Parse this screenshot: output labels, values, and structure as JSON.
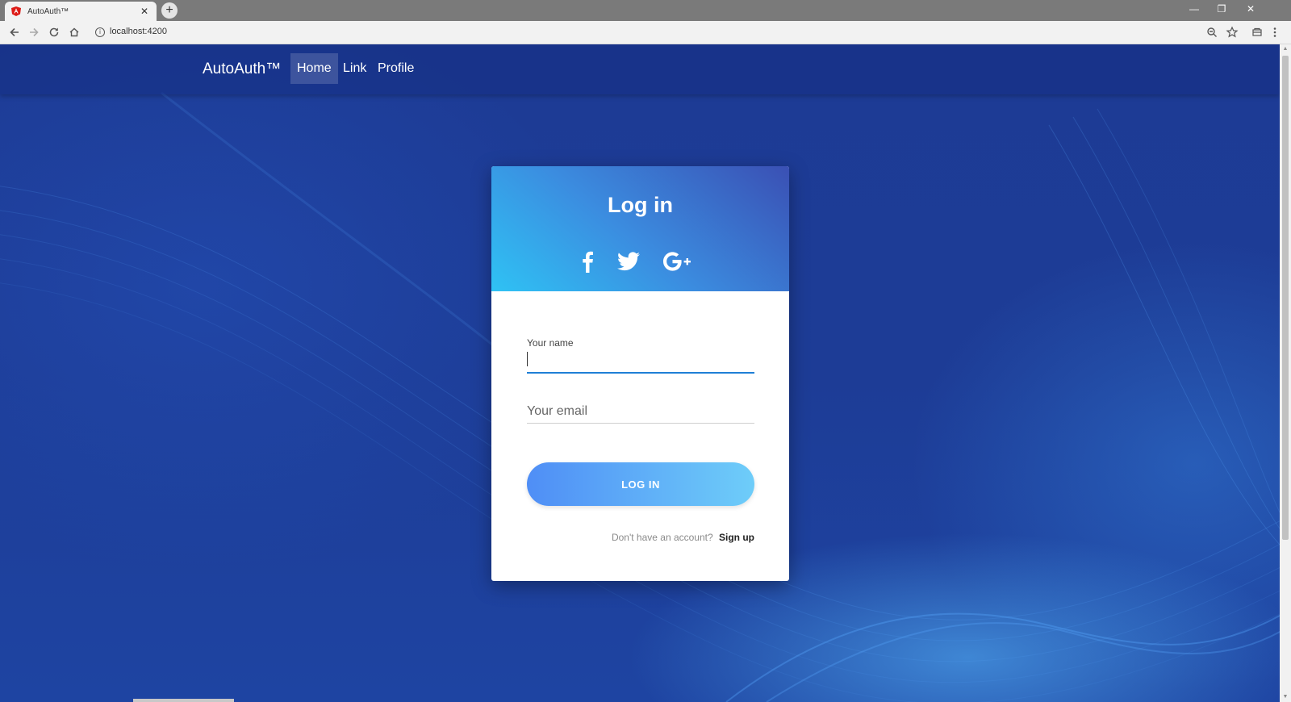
{
  "browser": {
    "tab_title": "AutoAuth™",
    "tab_icon": "angular-icon",
    "new_tab": "+",
    "url": "localhost:4200",
    "window_controls": {
      "minimize": "—",
      "restore": "❐",
      "close": "✕"
    }
  },
  "navbar": {
    "brand": "AutoAuth™",
    "links": [
      {
        "label": "Home",
        "active": true
      },
      {
        "label": "Link",
        "active": false
      },
      {
        "label": "Profile",
        "active": false
      }
    ]
  },
  "login_card": {
    "title": "Log in",
    "social": [
      "facebook-icon",
      "twitter-icon",
      "google-plus-icon"
    ],
    "name_label": "Your name",
    "name_value": "",
    "email_placeholder": "Your email",
    "submit_label": "LOG IN",
    "signup_prompt": "Don't have an account?",
    "signup_link": "Sign up"
  },
  "colors": {
    "header_gradient_start": "#2fc2f4",
    "header_gradient_end": "#3a50b4",
    "button_gradient_start": "#4f8ef6",
    "button_gradient_end": "#6ecdf9",
    "active_field_underline": "#1f7fd6",
    "page_background": "#1d3b95"
  }
}
